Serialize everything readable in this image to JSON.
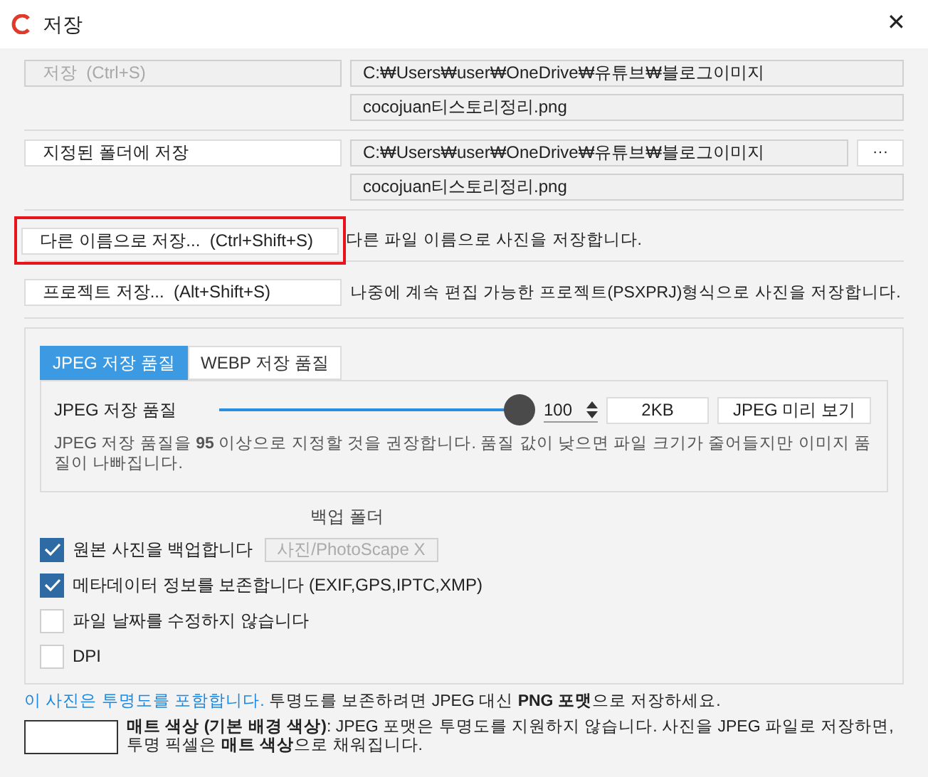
{
  "window": {
    "title": "저장",
    "close": "✕"
  },
  "save_sections": [
    {
      "button": {
        "label": "저장  (Ctrl+S)",
        "disabled": true
      },
      "folder": "C:₩Users₩user₩OneDrive₩유튜브₩블로그이미지",
      "filename": "cocojuan티스토리정리.png"
    },
    {
      "button": {
        "label": "지정된 폴더에 저장",
        "disabled": false
      },
      "folder": "C:₩Users₩user₩OneDrive₩유튜브₩블로그이미지",
      "filename": "cocojuan티스토리정리.png",
      "browse": "···"
    }
  ],
  "actions": [
    {
      "label": "다른 이름으로 저장...  (Ctrl+Shift+S)",
      "description": "다른 파일 이름으로 사진을 저장합니다.",
      "highlighted": true
    },
    {
      "label": "프로젝트 저장...  (Alt+Shift+S)",
      "description": "나중에 계속 편집 가능한 프로젝트(PSXPRJ)형식으로 사진을 저장합니다.",
      "highlighted": false
    }
  ],
  "quality_tabs": [
    {
      "label": "JPEG 저장 품질",
      "selected": true
    },
    {
      "label": "WEBP 저장 품질",
      "selected": false
    }
  ],
  "quality": {
    "label": "JPEG 저장 품질",
    "level": 1.0,
    "value": "100",
    "size": "2KB",
    "preview_button": "JPEG 미리 보기",
    "hint": "JPEG 저장 품질을 **95** 이상으로 지정할 것을 권장합니다. 품질 값이 낮으면 파일 크기가 줄어들지만 이미지 품질이 나빠집니다."
  },
  "backup_folder_label": "백업 폴더",
  "options": [
    {
      "label": "원본 사진을 백업합니다",
      "checked": true,
      "folder": "사진/PhotoScape X"
    },
    {
      "label": "메타데이터 정보를 보존합니다 (EXIF,GPS,IPTC,XMP)",
      "checked": true
    },
    {
      "label": "파일 날짜를 수정하지 않습니다",
      "checked": false
    },
    {
      "label": "DPI",
      "checked": false
    }
  ],
  "transparency_notice": {
    "link": "이 사진은 투명도를 포함합니다.",
    "text": "투명도를 보존하려면 JPEG 대신 **PNG 포맷**으로 저장하세요."
  },
  "matte": {
    "color": "#ffffff",
    "text": "**매트 색상 (기본 배경 색상)**: JPEG 포맷은 투명도를 지원하지 않습니다. 사진을 JPEG 파일로 저장하면, 투명 픽셀은 **매트 색상**으로 채워집니다."
  }
}
